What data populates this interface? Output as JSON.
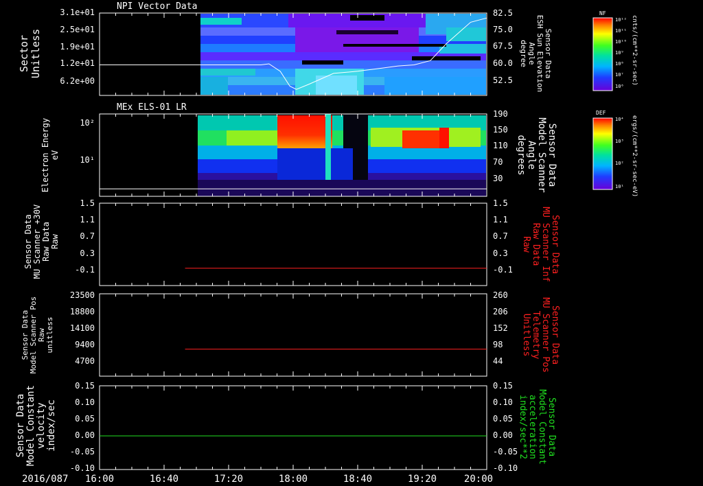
{
  "time_axis": {
    "date_label": "2016/087",
    "ticks": [
      "16:00",
      "16:40",
      "17:20",
      "18:00",
      "18:40",
      "19:20",
      "20:00"
    ],
    "start": "16:00",
    "end": "20:00"
  },
  "colorbars": [
    {
      "tag": "NF",
      "unit": "cnts/(cm**2-sr-sec)",
      "tick_labels": [
        "10¹²",
        "10¹¹",
        "10¹⁰",
        "10⁹",
        "10⁸",
        "10⁷",
        "10⁶"
      ]
    },
    {
      "tag": "DEF",
      "unit": "ergs/(cm**2-sr-sec-eV)",
      "tick_labels": [
        "10⁴",
        "10³",
        "10²",
        "10¹"
      ]
    }
  ],
  "panels": [
    {
      "title": "NPI Vector Data",
      "left_label": [
        "Sector",
        "Unitless"
      ],
      "left_ticks": [
        "3.1e+01",
        "2.5e+01",
        "1.9e+01",
        "1.2e+01",
        "6.2e+00"
      ],
      "right_label": [
        "Sensor Data",
        "ESH Sun Elevation",
        "Angle",
        "degree"
      ],
      "right_ticks": [
        "82.5",
        "75.0",
        "67.5",
        "60.0",
        "52.5"
      ],
      "right_label_color": "#ffffff"
    },
    {
      "title": "MEx ELS-01 LR",
      "left_label": [
        "Electron Energy",
        "eV"
      ],
      "left_ticks": [
        "10²",
        "10¹"
      ],
      "right_label": [
        "Sensor Data",
        "Model Scanner",
        "Angle",
        "degrees"
      ],
      "right_ticks": [
        "190",
        "150",
        "110",
        "70",
        "30"
      ],
      "right_label_color": "#ffffff"
    },
    {
      "title": "",
      "left_label": [
        "Sensor Data",
        "MU Scanner +30V",
        "Raw Data",
        "Raw"
      ],
      "left_ticks": [
        "1.5",
        "1.1",
        "0.7",
        "0.3",
        "-0.1"
      ],
      "right_label": [
        "Sensor Data",
        "MU Scanner Inf",
        "Raw Data",
        "Raw"
      ],
      "right_ticks": [
        "1.5",
        "1.1",
        "0.7",
        "0.3",
        "-0.1"
      ],
      "right_label_color": "#ff2020"
    },
    {
      "title": "",
      "left_label": [
        "Sensor Data",
        "Model Scanner Pos",
        "Raw",
        "unitless"
      ],
      "left_ticks": [
        "23500",
        "18800",
        "14100",
        "9400",
        "4700"
      ],
      "right_label": [
        "Sensor Data",
        "MU Scanner Pos",
        "Telemetry",
        "Unitless"
      ],
      "right_ticks": [
        "260",
        "206",
        "152",
        "98",
        "44"
      ],
      "right_label_color": "#ff2020"
    },
    {
      "title": "",
      "left_label": [
        "Sensor Data",
        "Model Constant",
        "velocity",
        "index/sec"
      ],
      "left_ticks": [
        "0.15",
        "0.10",
        "0.05",
        "0.00",
        "-0.05",
        "-0.10"
      ],
      "right_label": [
        "Sensor Data",
        "Model Constant",
        "acceleration",
        "index/sec**2"
      ],
      "right_ticks": [
        "0.15",
        "0.10",
        "0.05",
        "0.00",
        "-0.05",
        "-0.10"
      ],
      "right_label_color": "#20e020"
    }
  ],
  "chart_data": [
    {
      "type": "heatmap",
      "title": "NPI Vector Data",
      "ylabel": "Sector Unitless",
      "y2label": "Sensor Data ESH Sun Elevation Angle degree",
      "data_start": "17:05",
      "overlay_line": {
        "name": "ESH Sun Elevation Angle",
        "color": "#ffffff",
        "x": [
          "16:00",
          "17:40",
          "17:45",
          "17:52",
          "17:58",
          "18:02",
          "18:10",
          "18:25",
          "18:40",
          "18:55",
          "19:05",
          "19:15",
          "19:25",
          "19:35",
          "19:50",
          "20:00"
        ],
        "y": [
          60.0,
          60.0,
          60.5,
          57.0,
          50.0,
          48.5,
          51.0,
          56.0,
          57.0,
          58.5,
          59.5,
          60.0,
          62.0,
          70.0,
          80.0,
          82.0
        ],
        "ylim": [
          46.0,
          84.0
        ]
      }
    },
    {
      "type": "heatmap",
      "title": "MEx ELS-01 LR",
      "ylabel": "Electron Energy eV",
      "y2label": "Sensor Data Model Scanner Angle degrees",
      "data_start": "17:04",
      "overlay_line": {
        "name": "Model Scanner Angle",
        "color": "#ffffff",
        "x": [
          "16:00",
          "20:00"
        ],
        "y": [
          16,
          16
        ],
        "ylim": [
          0,
          190
        ]
      }
    },
    {
      "type": "line",
      "series": [
        {
          "name": "MU Scanner Inf Raw Data",
          "color": "#ff2020",
          "x": [
            "16:53",
            "20:00"
          ],
          "y": [
            -0.05,
            -0.05
          ]
        }
      ],
      "ylim": [
        -0.45,
        1.5
      ]
    },
    {
      "type": "line",
      "series": [
        {
          "name": "MU Scanner Pos Telemetry",
          "color": "#ff2020",
          "x": [
            "16:53",
            "20:00"
          ],
          "y": [
            7650,
            7650
          ]
        }
      ],
      "ylim": [
        0,
        23500
      ]
    },
    {
      "type": "line",
      "series": [
        {
          "name": "Model Constant acceleration",
          "color": "#20e020",
          "x": [
            "16:00",
            "20:00"
          ],
          "y": [
            0.0,
            0.0
          ]
        }
      ],
      "ylim": [
        -0.1,
        0.15
      ]
    }
  ]
}
